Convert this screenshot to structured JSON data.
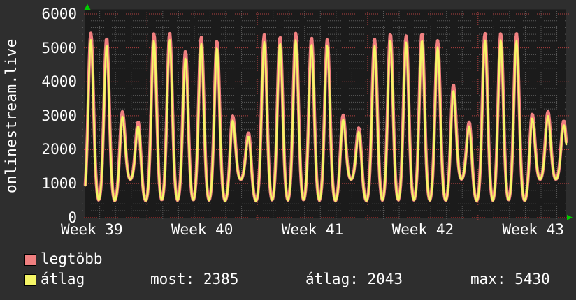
{
  "title": "onlinestream.live",
  "legend": {
    "max_label": "legtöbb",
    "avg_label": "átlag"
  },
  "stats": {
    "most_text": "most: 2385",
    "avg_text": "átlag: 2043",
    "max_text": "max: 5430",
    "most": 2385,
    "atlag": 2043,
    "max": 5430
  },
  "colors": {
    "background": "#2e2e2e",
    "canvas": "#1b1b1b",
    "text": "#ffffff",
    "grid_minor": "#5a5a5a",
    "grid_major": "#b04040",
    "axis_line": "#7a2525",
    "arrow": "#00cc00",
    "max_line": "#f08080",
    "avg_line": "#f5f566"
  },
  "chart_data": {
    "type": "line",
    "title": "onlinestream.live",
    "xlabel": "",
    "ylabel": "",
    "ylim": [
      0,
      6200
    ],
    "y_ticks": [
      0,
      1000,
      2000,
      3000,
      4000,
      5000,
      6000
    ],
    "y_minor_step": 200,
    "x_tick_labels": [
      "Week 39",
      "Week 40",
      "Week 41",
      "Week 42",
      "Week 43"
    ],
    "grid": true,
    "legend_position": "bottom-left",
    "days_shown": 31,
    "days_per_week": 7,
    "week_boundary_day_index": 4,
    "series": [
      {
        "name": "legtöbb",
        "color": "#f08080",
        "daily_peaks": [
          5430,
          5290,
          3120,
          2815,
          5420,
          5430,
          4905,
          5315,
          5210,
          2990,
          2500,
          5385,
          5330,
          5430,
          5295,
          5250,
          3020,
          2645,
          5250,
          5420,
          5350,
          5430,
          5213,
          3911,
          2815,
          5430,
          5430,
          5420,
          3055,
          3124,
          2850
        ]
      },
      {
        "name": "átlag",
        "color": "#f5f566",
        "daily_peaks": [
          5230,
          5080,
          2980,
          2690,
          5220,
          5240,
          4700,
          5120,
          5010,
          2860,
          2390,
          5180,
          5140,
          5230,
          5100,
          5060,
          2890,
          2530,
          5060,
          5230,
          5160,
          5230,
          5020,
          3740,
          2690,
          5230,
          5240,
          5220,
          2930,
          2990,
          2730
        ]
      }
    ],
    "night_trough_typical": 450,
    "weekend_night_trough": 1100,
    "current": 2385,
    "average": 2043,
    "maximum": 5430
  }
}
